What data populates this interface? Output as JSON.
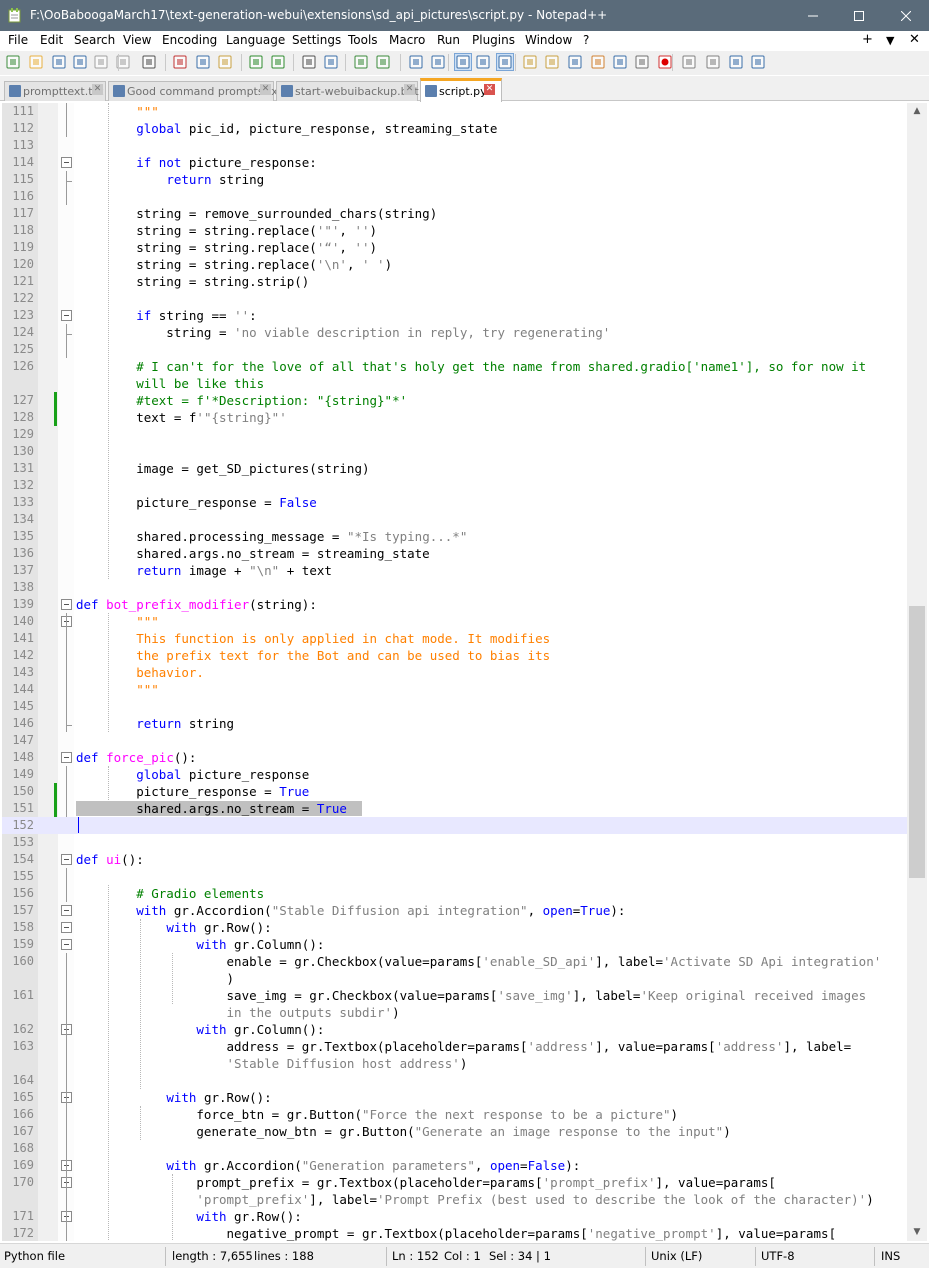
{
  "window": {
    "title": "F:\\OoBaboogaMarch17\\text-generation-webui\\extensions\\sd_api_pictures\\script.py - Notepad++"
  },
  "menu": [
    "File",
    "Edit",
    "Search",
    "View",
    "Encoding",
    "Language",
    "Settings",
    "Tools",
    "Macro",
    "Run",
    "Plugins",
    "Window",
    "?"
  ],
  "menu_right": [
    "+",
    "▼",
    "✕"
  ],
  "toolbar_icons": [
    "new-file-icon",
    "open-file-icon",
    "save-icon",
    "save-all-icon",
    "close-icon",
    "close-all-icon",
    "print-icon",
    "cut-icon",
    "copy-icon",
    "paste-icon",
    "undo-icon",
    "redo-icon",
    "find-icon",
    "replace-icon",
    "zoom-in-icon",
    "zoom-out-icon",
    "sync-vertical-icon",
    "sync-horizontal-icon",
    "word-wrap-icon",
    "show-all-chars-icon",
    "indent-guide-icon",
    "udl-icon",
    "doc-map-icon",
    "function-list-icon",
    "folder-workspace-icon",
    "doc-list-icon",
    "monitoring-icon",
    "record-macro-icon",
    "stop-record-icon",
    "play-macro-icon",
    "play-multiple-icon",
    "save-macro-icon"
  ],
  "tabs": [
    {
      "label": "prompttext.txt",
      "active": false
    },
    {
      "label": "Good command prompts.txt",
      "active": false
    },
    {
      "label": "start-webuibackup.bat",
      "active": false
    },
    {
      "label": "script.py",
      "active": true
    }
  ],
  "status": {
    "filetype": "Python file",
    "length": "length : 7,655",
    "lines": "lines : 188",
    "ln": "Ln : 152",
    "col": "Col : 1",
    "sel": "Sel : 34 | 1",
    "eol": "Unix (LF)",
    "encoding": "UTF-8",
    "mode": "INS"
  },
  "code_lines": [
    {
      "n": "111",
      "t": [
        [
          "ds",
          "        \"\"\""
        ]
      ]
    },
    {
      "n": "112",
      "t": [
        [
          "",
          "        "
        ],
        [
          "k",
          "global"
        ],
        [
          "",
          " pic_id, picture_response, streaming_state"
        ]
      ]
    },
    {
      "n": "113",
      "t": []
    },
    {
      "n": "114",
      "t": [
        [
          "",
          "        "
        ],
        [
          "k",
          "if not"
        ],
        [
          "",
          " picture_response:"
        ]
      ]
    },
    {
      "n": "115",
      "t": [
        [
          "",
          "            "
        ],
        [
          "k",
          "return"
        ],
        [
          "",
          " string"
        ]
      ]
    },
    {
      "n": "116",
      "t": []
    },
    {
      "n": "117",
      "t": [
        [
          "",
          "        string = remove_surrounded_chars(string)"
        ]
      ]
    },
    {
      "n": "118",
      "t": [
        [
          "",
          "        string = string.replace("
        ],
        [
          "s",
          "'\"'"
        ],
        [
          "",
          ", "
        ],
        [
          "s",
          "''"
        ],
        [
          "",
          ")"
        ]
      ]
    },
    {
      "n": "119",
      "t": [
        [
          "",
          "        string = string.replace("
        ],
        [
          "s",
          "'“'"
        ],
        [
          "",
          ", "
        ],
        [
          "s",
          "''"
        ],
        [
          "",
          ")"
        ]
      ]
    },
    {
      "n": "120",
      "t": [
        [
          "",
          "        string = string.replace("
        ],
        [
          "s",
          "'\\n'"
        ],
        [
          "",
          ", "
        ],
        [
          "s",
          "' '"
        ],
        [
          "",
          ")"
        ]
      ]
    },
    {
      "n": "121",
      "t": [
        [
          "",
          "        string = string.strip()"
        ]
      ]
    },
    {
      "n": "122",
      "t": []
    },
    {
      "n": "123",
      "t": [
        [
          "",
          "        "
        ],
        [
          "k",
          "if"
        ],
        [
          "",
          " string == "
        ],
        [
          "s",
          "''"
        ],
        [
          "",
          ":"
        ]
      ]
    },
    {
      "n": "124",
      "t": [
        [
          "",
          "            string = "
        ],
        [
          "s",
          "'no viable description in reply, try regenerating'"
        ]
      ]
    },
    {
      "n": "125",
      "t": []
    },
    {
      "n": "126",
      "t": [
        [
          "c",
          "        # I can't for the love of all that's holy get the name from shared.gradio['name1'], so for now it"
        ]
      ]
    },
    {
      "n": "",
      "t": [
        [
          "c",
          "        will be like this"
        ]
      ]
    },
    {
      "n": "127",
      "t": [
        [
          "c",
          "        #text = f'*Description: \"{string}\"*'"
        ]
      ]
    },
    {
      "n": "128",
      "t": [
        [
          "",
          "        text = f"
        ],
        [
          "s",
          "'\"{string}\"'"
        ]
      ]
    },
    {
      "n": "129",
      "t": []
    },
    {
      "n": "130",
      "t": []
    },
    {
      "n": "131",
      "t": [
        [
          "",
          "        image = get_SD_pictures(string)"
        ]
      ]
    },
    {
      "n": "132",
      "t": []
    },
    {
      "n": "133",
      "t": [
        [
          "",
          "        picture_response = "
        ],
        [
          "k",
          "False"
        ]
      ]
    },
    {
      "n": "134",
      "t": []
    },
    {
      "n": "135",
      "t": [
        [
          "",
          "        shared.processing_message = "
        ],
        [
          "s",
          "\"*Is typing...*\""
        ]
      ]
    },
    {
      "n": "136",
      "t": [
        [
          "",
          "        shared.args.no_stream = streaming_state"
        ]
      ]
    },
    {
      "n": "137",
      "t": [
        [
          "",
          "        "
        ],
        [
          "k",
          "return"
        ],
        [
          "",
          " image + "
        ],
        [
          "s",
          "\"\\n\""
        ],
        [
          "",
          " + text"
        ]
      ]
    },
    {
      "n": "138",
      "t": []
    },
    {
      "n": "139",
      "t": [
        [
          "k2",
          "def"
        ],
        [
          "",
          " "
        ],
        [
          "fn",
          "bot_prefix_modifier"
        ],
        [
          "",
          "(string):"
        ]
      ]
    },
    {
      "n": "140",
      "t": [
        [
          "ds",
          "        \"\"\""
        ]
      ]
    },
    {
      "n": "141",
      "t": [
        [
          "ds",
          "        This function is only applied in chat mode. It modifies"
        ]
      ]
    },
    {
      "n": "142",
      "t": [
        [
          "ds",
          "        the prefix text for the Bot and can be used to bias its"
        ]
      ]
    },
    {
      "n": "143",
      "t": [
        [
          "ds",
          "        behavior."
        ]
      ]
    },
    {
      "n": "144",
      "t": [
        [
          "ds",
          "        \"\"\""
        ]
      ]
    },
    {
      "n": "145",
      "t": []
    },
    {
      "n": "146",
      "t": [
        [
          "",
          "        "
        ],
        [
          "k",
          "return"
        ],
        [
          "",
          " string"
        ]
      ]
    },
    {
      "n": "147",
      "t": []
    },
    {
      "n": "148",
      "t": [
        [
          "k2",
          "def"
        ],
        [
          "",
          " "
        ],
        [
          "fn",
          "force_pic"
        ],
        [
          "",
          "():"
        ]
      ]
    },
    {
      "n": "149",
      "t": [
        [
          "",
          "        "
        ],
        [
          "k",
          "global"
        ],
        [
          "",
          " picture_response"
        ]
      ]
    },
    {
      "n": "150",
      "t": [
        [
          "",
          "        picture_response = "
        ],
        [
          "k",
          "True"
        ]
      ]
    },
    {
      "n": "151",
      "t": [
        [
          "sel",
          ""
        ],
        [
          "",
          ""
        ]
      ]
    },
    {
      "n": "152",
      "t": []
    },
    {
      "n": "153",
      "t": []
    },
    {
      "n": "154",
      "t": [
        [
          "k2",
          "def"
        ],
        [
          "",
          " "
        ],
        [
          "fn",
          "ui"
        ],
        [
          "",
          "():"
        ]
      ]
    },
    {
      "n": "155",
      "t": []
    },
    {
      "n": "156",
      "t": [
        [
          "c",
          "        # Gradio elements"
        ]
      ]
    },
    {
      "n": "157",
      "t": [
        [
          "",
          "        "
        ],
        [
          "k",
          "with"
        ],
        [
          "",
          " gr.Accordion("
        ],
        [
          "s",
          "\"Stable Diffusion api integration\""
        ],
        [
          "",
          ", "
        ],
        [
          "k",
          "open"
        ],
        [
          "",
          "="
        ],
        [
          "k",
          "True"
        ],
        [
          "",
          "):"
        ]
      ]
    },
    {
      "n": "158",
      "t": [
        [
          "",
          "            "
        ],
        [
          "k",
          "with"
        ],
        [
          "",
          " gr.Row():"
        ]
      ]
    },
    {
      "n": "159",
      "t": [
        [
          "",
          "                "
        ],
        [
          "k",
          "with"
        ],
        [
          "",
          " gr.Column():"
        ]
      ]
    },
    {
      "n": "160",
      "t": [
        [
          "",
          "                    enable = gr.Checkbox(value=params["
        ],
        [
          "s",
          "'enable_SD_api'"
        ],
        [
          "",
          "], label="
        ],
        [
          "s",
          "'Activate SD Api integration'"
        ]
      ]
    },
    {
      "n": "",
      "t": [
        [
          "",
          "                    )"
        ]
      ]
    },
    {
      "n": "161",
      "t": [
        [
          "",
          "                    save_img = gr.Checkbox(value=params["
        ],
        [
          "s",
          "'save_img'"
        ],
        [
          "",
          "], label="
        ],
        [
          "s",
          "'Keep original received images"
        ]
      ]
    },
    {
      "n": "",
      "t": [
        [
          "s",
          "                    in the outputs subdir'"
        ],
        [
          "",
          ")"
        ]
      ]
    },
    {
      "n": "162",
      "t": [
        [
          "",
          "                "
        ],
        [
          "k",
          "with"
        ],
        [
          "",
          " gr.Column():"
        ]
      ]
    },
    {
      "n": "163",
      "t": [
        [
          "",
          "                    address = gr.Textbox(placeholder=params["
        ],
        [
          "s",
          "'address'"
        ],
        [
          "",
          "], value=params["
        ],
        [
          "s",
          "'address'"
        ],
        [
          "",
          "], label="
        ]
      ]
    },
    {
      "n": "",
      "t": [
        [
          "s",
          "                    'Stable Diffusion host address'"
        ],
        [
          "",
          ")"
        ]
      ]
    },
    {
      "n": "164",
      "t": []
    },
    {
      "n": "165",
      "t": [
        [
          "",
          "            "
        ],
        [
          "k",
          "with"
        ],
        [
          "",
          " gr.Row():"
        ]
      ]
    },
    {
      "n": "166",
      "t": [
        [
          "",
          "                force_btn = gr.Button("
        ],
        [
          "s",
          "\"Force the next response to be a picture\""
        ],
        [
          "",
          ")"
        ]
      ]
    },
    {
      "n": "167",
      "t": [
        [
          "",
          "                generate_now_btn = gr.Button("
        ],
        [
          "s",
          "\"Generate an image response to the input\""
        ],
        [
          "",
          ")"
        ]
      ]
    },
    {
      "n": "168",
      "t": []
    },
    {
      "n": "169",
      "t": [
        [
          "",
          "            "
        ],
        [
          "k",
          "with"
        ],
        [
          "",
          " gr.Accordion("
        ],
        [
          "s",
          "\"Generation parameters\""
        ],
        [
          "",
          ", "
        ],
        [
          "k",
          "open"
        ],
        [
          "",
          "="
        ],
        [
          "k",
          "False"
        ],
        [
          "",
          "):"
        ]
      ]
    },
    {
      "n": "170",
      "t": [
        [
          "",
          "                prompt_prefix = gr.Textbox(placeholder=params["
        ],
        [
          "s",
          "'prompt_prefix'"
        ],
        [
          "",
          "], value=params["
        ]
      ]
    },
    {
      "n": "",
      "t": [
        [
          "s",
          "                'prompt_prefix'"
        ],
        [
          "",
          "], label="
        ],
        [
          "s",
          "'Prompt Prefix (best used to describe the look of the character)'"
        ],
        [
          "",
          ")"
        ]
      ]
    },
    {
      "n": "171",
      "t": [
        [
          "",
          "                "
        ],
        [
          "k",
          "with"
        ],
        [
          "",
          " gr.Row():"
        ]
      ]
    },
    {
      "n": "172",
      "t": [
        [
          "",
          "                    negative_prompt = gr.Textbox(placeholder=params["
        ],
        [
          "s",
          "'negative_prompt'"
        ],
        [
          "",
          "], value=params["
        ]
      ]
    }
  ],
  "selected_text": "shared.args.no_stream = True"
}
